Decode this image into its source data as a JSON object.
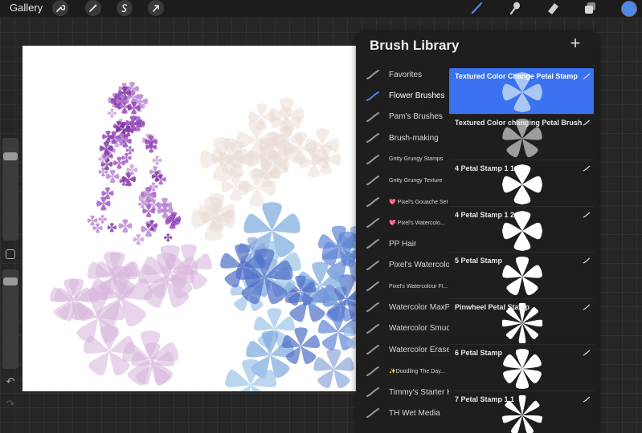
{
  "topbar": {
    "gallery_label": "Gallery",
    "left_tools": [
      "wrench-icon",
      "magic-wand-icon",
      "selection-icon",
      "transform-arrow-icon"
    ],
    "right_tools": [
      "brush-icon",
      "smudge-icon",
      "eraser-icon",
      "layers-icon"
    ],
    "active_tool": "brush-icon",
    "current_color": "#4f88e6"
  },
  "library": {
    "title": "Brush Library",
    "add_label": "+",
    "sets": [
      {
        "label": "Favorites",
        "small": false,
        "active": false
      },
      {
        "label": "Flower Brushes",
        "small": false,
        "active": true
      },
      {
        "label": "Pam's Brushes",
        "small": false,
        "active": false
      },
      {
        "label": "Brush-making",
        "small": false,
        "active": false
      },
      {
        "label": "Gritty Grungy Stamps",
        "small": true,
        "active": false
      },
      {
        "label": "Gritty Grungy Texture",
        "small": true,
        "active": false
      },
      {
        "label": "💖 Pixel's Gouache Set",
        "small": true,
        "active": false
      },
      {
        "label": "💖 Pixel's Watercolo...",
        "small": true,
        "active": false
      },
      {
        "label": "PP Hair",
        "small": false,
        "active": false
      },
      {
        "label": "Pixel's Watercolor",
        "small": false,
        "active": false
      },
      {
        "label": "Pixel's Watercolour Fl...",
        "small": true,
        "active": false
      },
      {
        "label": "Watercolor MaxPack",
        "small": false,
        "active": false
      },
      {
        "label": "Watercolor Smudge",
        "small": false,
        "active": false
      },
      {
        "label": "Watercolor Erasers",
        "small": false,
        "active": false
      },
      {
        "label": "✨Doodling The Day...",
        "small": true,
        "active": false
      },
      {
        "label": "Timmy's Starter Kit",
        "small": false,
        "active": false
      },
      {
        "label": "TH Wet Media",
        "small": false,
        "active": false
      }
    ],
    "brushes": [
      {
        "name": "Textured Color Change Petal Stamp",
        "stamp": "4",
        "fill": "#a9c7f2",
        "active": true
      },
      {
        "name": "Textured Color changing Petal Brush",
        "stamp": "5",
        "fill": "#9d9d9d",
        "active": false
      },
      {
        "name": "4 Petal Stamp 1 1",
        "stamp": "4",
        "fill": "#ffffff",
        "active": false
      },
      {
        "name": "4 Petal Stamp 1 2",
        "stamp": "4",
        "fill": "#ffffff",
        "active": false
      },
      {
        "name": "5 Petal Stamp",
        "stamp": "5",
        "fill": "#ffffff",
        "active": false
      },
      {
        "name": "Pinwheel Petal Stamp",
        "stamp": "8",
        "fill": "#ffffff",
        "active": false
      },
      {
        "name": "6 Petal Stamp",
        "stamp": "6",
        "fill": "#ffffff",
        "active": false
      },
      {
        "name": "7 Petal Stamp 1 1",
        "stamp": "7",
        "fill": "#ffffff",
        "active": false
      }
    ]
  },
  "colors": {
    "accent": "#3b72f1",
    "lilac": "#9b4fc0",
    "pink_flowers": "#d9b8dd",
    "blue_flowers": "#5f86d4",
    "beige_flowers": "#e9dcd6"
  }
}
